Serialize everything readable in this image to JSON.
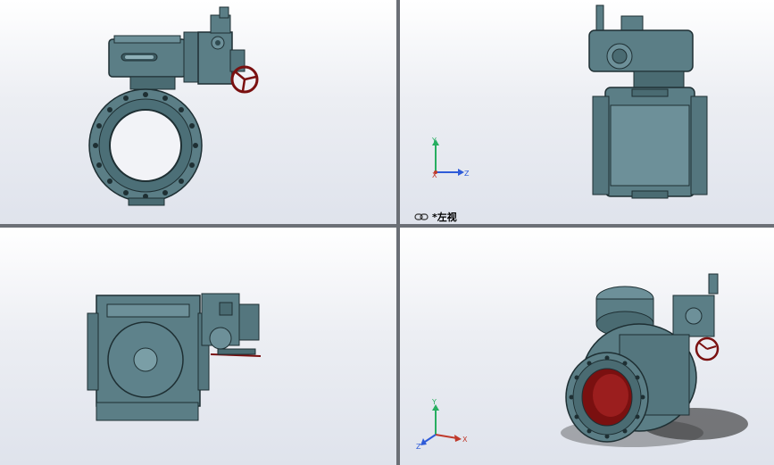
{
  "viewports": {
    "front": {
      "name": "front"
    },
    "left": {
      "name": "left",
      "label": "*左视"
    },
    "top": {
      "name": "top"
    },
    "iso": {
      "name": "isometric"
    }
  },
  "triad": {
    "x": "X",
    "y": "Y",
    "z": "Z"
  },
  "colors": {
    "body": "#5b7e86",
    "body_dark": "#2f4a50",
    "body_light": "#8fb0b8",
    "bore_red": "#7a1010",
    "handwheel": "#7a1010",
    "axis_x": "#c0392b",
    "axis_y": "#27ae60",
    "axis_z": "#2e5bd8"
  }
}
